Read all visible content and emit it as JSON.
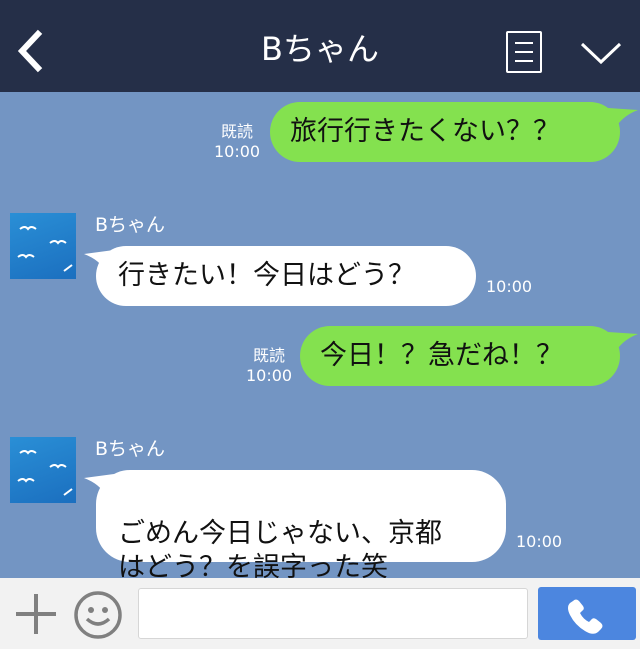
{
  "header": {
    "title": "Bちゃん",
    "back_icon": "chevron-left-icon",
    "menu_icon": "menu-lines-icon",
    "expand_icon": "chevron-down-icon"
  },
  "messages": [
    {
      "type": "sent",
      "text": "旅行行きたくない？？",
      "read_label": "既読",
      "time": "10:00"
    },
    {
      "type": "received",
      "sender": "Bちゃん",
      "text": "行きたい！今日はどう？",
      "time": "10:00"
    },
    {
      "type": "sent",
      "text": "今日！？急だね！？",
      "read_label": "既読",
      "time": "10:00"
    },
    {
      "type": "received",
      "sender": "Bちゃん",
      "text": "ごめん今日じゃない、京都\nはどう？を誤字った笑",
      "time": "10:00"
    }
  ],
  "composer": {
    "input_value": "",
    "plus_icon": "plus-icon",
    "emoji_icon": "smiley-icon",
    "call_icon": "phone-icon"
  },
  "colors": {
    "header_bg": "#252f48",
    "chat_bg": "#7395c3",
    "sent_bubble": "#84e14f",
    "received_bubble": "#ffffff",
    "call_button": "#4c86df"
  }
}
